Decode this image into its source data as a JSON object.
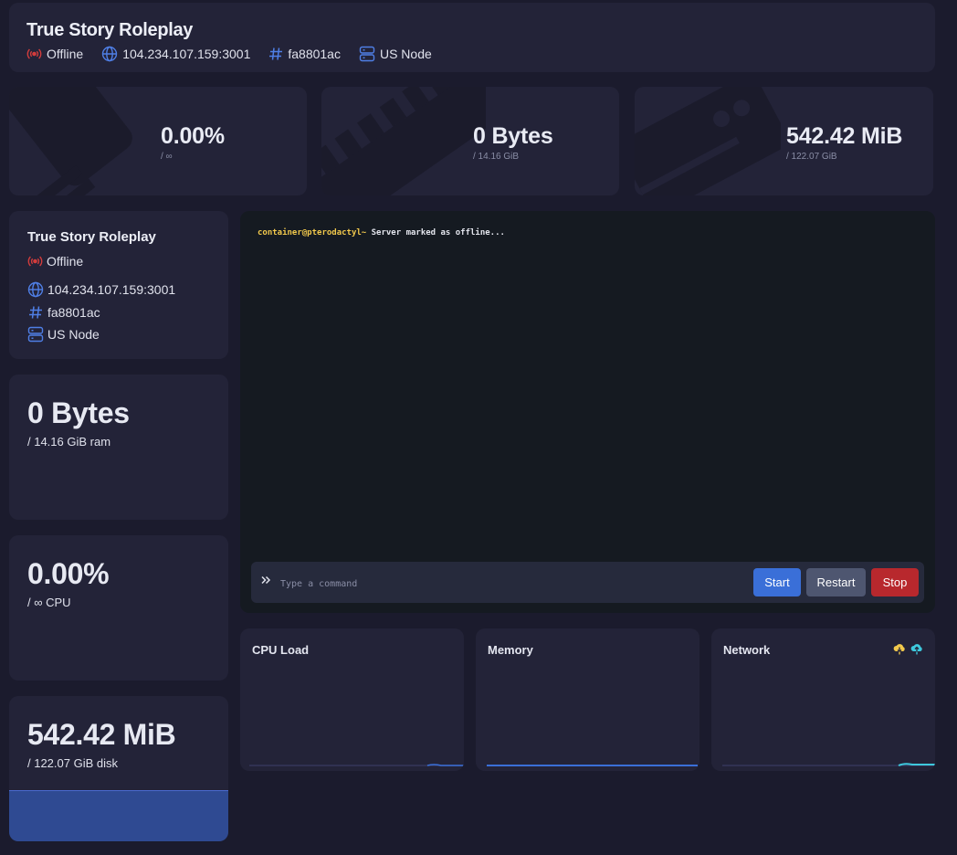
{
  "header": {
    "title": "True Story Roleplay",
    "status": "Offline",
    "address": "104.234.107.159:3001",
    "id": "fa8801ac",
    "node": "US Node"
  },
  "stats": {
    "cpu": {
      "value": "0.00%",
      "limit": "/ ∞"
    },
    "memory": {
      "value": "0 Bytes",
      "limit": "/ 14.16 GiB"
    },
    "disk": {
      "value": "542.42 MiB",
      "limit": "/ 122.07 GiB"
    }
  },
  "info": {
    "title": "True Story Roleplay",
    "status": "Offline",
    "address": "104.234.107.159:3001",
    "id": "fa8801ac",
    "node": "US Node"
  },
  "ram_card": {
    "value": "0 Bytes",
    "sub": "/ 14.16 GiB ram",
    "fill": 0.0
  },
  "cpu_card": {
    "value": "0.00%",
    "sub": "/ ∞ CPU",
    "fill": 0.0
  },
  "disk_card": {
    "value": "542.42 MiB",
    "sub": "/ 122.07 GiB disk",
    "fill": 0.35
  },
  "console": {
    "prompt": "container@pterodactyl~",
    "message": " Server marked as offline...",
    "placeholder": "Type a command",
    "start_label": "Start",
    "restart_label": "Restart",
    "stop_label": "Stop"
  },
  "graphs": {
    "cpu_title": "CPU Load",
    "memory_title": "Memory",
    "network_title": "Network"
  },
  "colors": {
    "offline": "#d23c3c",
    "accent": "#3a6fd8",
    "start": "#3a6fd8",
    "restart": "#4e5670",
    "stop": "#b8282d",
    "net_in": "#f2c94c",
    "net_out": "#3ec9dd",
    "disk_fill": "#2f4a92"
  },
  "icons": {
    "status": "signal-broadcast-icon",
    "address": "globe-icon",
    "id": "hashtag-icon",
    "node": "server-icon",
    "command": "chevron-double-right-icon",
    "net_in": "cloud-download-icon",
    "net_out": "cloud-upload-icon"
  }
}
